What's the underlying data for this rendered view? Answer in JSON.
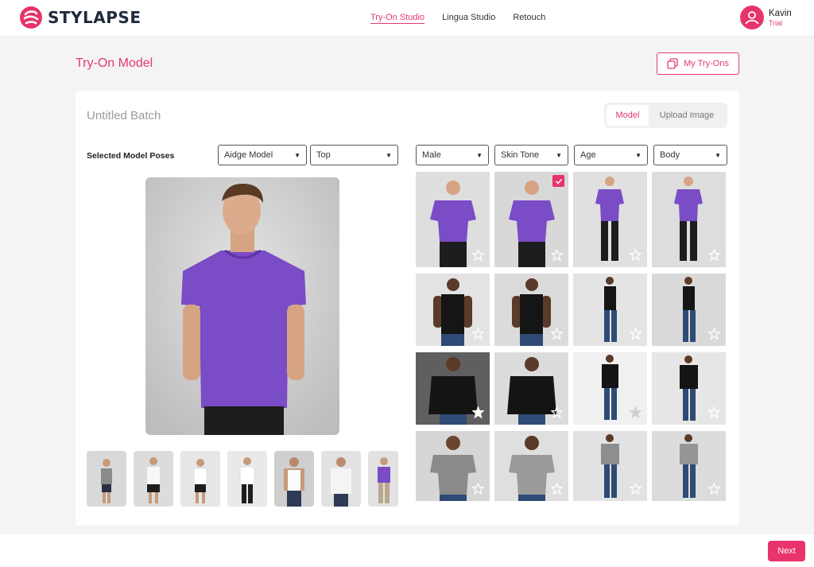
{
  "app": {
    "brand": "STYLAPSE"
  },
  "nav": {
    "items": [
      "Try-On Studio",
      "Lingua Studio",
      "Retouch"
    ],
    "active": 0
  },
  "user": {
    "name": "Kavin",
    "plan": "Trial"
  },
  "page": {
    "title": "Try-On Model",
    "my_tryons_label": "My Try-Ons"
  },
  "batch": {
    "name": "Untitled Batch"
  },
  "source_toggle": {
    "options": [
      "Model",
      "Upload Image"
    ],
    "selected": "Model"
  },
  "left_panel": {
    "selected_label": "Selected Model Poses",
    "dropdowns": [
      "Aidge Model",
      "Top"
    ]
  },
  "filters": [
    "Male",
    "Skin Tone",
    "Age",
    "Body"
  ],
  "footer": {
    "next_label": "Next"
  },
  "colors": {
    "accent": "#e8336b",
    "accent_text": "#e23a6e",
    "shirt_purple": "#7a4cc6"
  }
}
